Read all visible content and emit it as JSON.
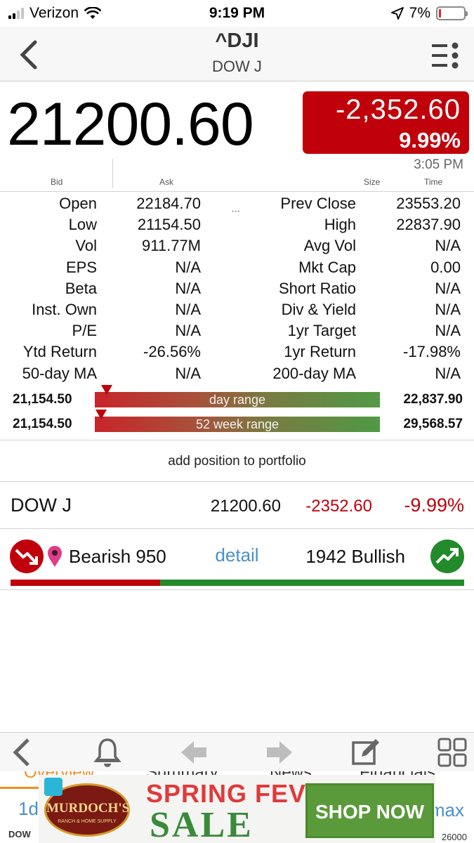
{
  "status_bar": {
    "carrier": "Verizon",
    "time": "9:19 PM",
    "battery_pct": "7%",
    "battery_level": 0.07
  },
  "nav": {
    "title": "^DJI",
    "subtitle": "DOW J"
  },
  "quote": {
    "price": "21200.60",
    "change": "-2,352.60",
    "change_pct": "9.99%",
    "time": "3:05 PM",
    "labels": {
      "bid": "Bid",
      "ask": "Ask",
      "size": "Size",
      "time": "Time"
    }
  },
  "stats": [
    {
      "l1": "Open",
      "v1": "22184.70",
      "l2": "Prev Close",
      "v2": "23553.20"
    },
    {
      "l1": "Low",
      "v1": "21154.50",
      "l2": "High",
      "v2": "22837.90"
    },
    {
      "l1": "Vol",
      "v1": "911.77M",
      "l2": "Avg Vol",
      "v2": "N/A"
    },
    {
      "l1": "EPS",
      "v1": "N/A",
      "l2": "Mkt Cap",
      "v2": "0.00"
    },
    {
      "l1": "Beta",
      "v1": "N/A",
      "l2": "Short Ratio",
      "v2": "N/A"
    },
    {
      "l1": "Inst. Own",
      "v1": "N/A",
      "l2": "Div & Yield",
      "v2": "N/A"
    },
    {
      "l1": "P/E",
      "v1": "N/A",
      "l2": "1yr Target",
      "v2": "N/A"
    },
    {
      "l1": "Ytd Return",
      "v1": "-26.56%",
      "l2": "1yr Return",
      "v2": "-17.98%"
    },
    {
      "l1": "50-day MA",
      "v1": "N/A",
      "l2": "200-day MA",
      "v2": "N/A"
    }
  ],
  "ranges": [
    {
      "low": "21,154.50",
      "label": "day range",
      "high": "22,837.90",
      "position": 0.02
    },
    {
      "low": "21,154.50",
      "label": "52 week range",
      "high": "29,568.57",
      "position": 0.0
    }
  ],
  "add_position": "add position to portfolio",
  "symbol_row": {
    "name": "DOW J",
    "price": "21200.60",
    "change": "-2352.60",
    "change_pct": "-9.99%"
  },
  "sentiment": {
    "bearish": "Bearish 950",
    "detail": "detail",
    "bullish": "1942 Bullish",
    "bear_fraction": 0.33,
    "bear_color": "#c0000b",
    "bull_color": "#238a2b"
  },
  "behind_ad": {
    "tabs": [
      "Overview",
      "Summary",
      "News",
      "Financials"
    ],
    "period_left": "1d",
    "period_right": "max",
    "symbol": "DOW",
    "axis_value": "26000"
  },
  "ad": {
    "brand": "MURDOCH'S",
    "brand_sub": "RANCH & HOME SUPPLY",
    "line1": "SPRING FEVER",
    "line2": "SALE",
    "button": "SHOP NOW"
  },
  "icons": [
    "back-icon",
    "menu-icon",
    "bell-icon",
    "arrow-left-icon",
    "arrow-right-icon",
    "edit-icon",
    "grid-icon",
    "bearish-icon",
    "bullish-icon",
    "pin-icon"
  ]
}
